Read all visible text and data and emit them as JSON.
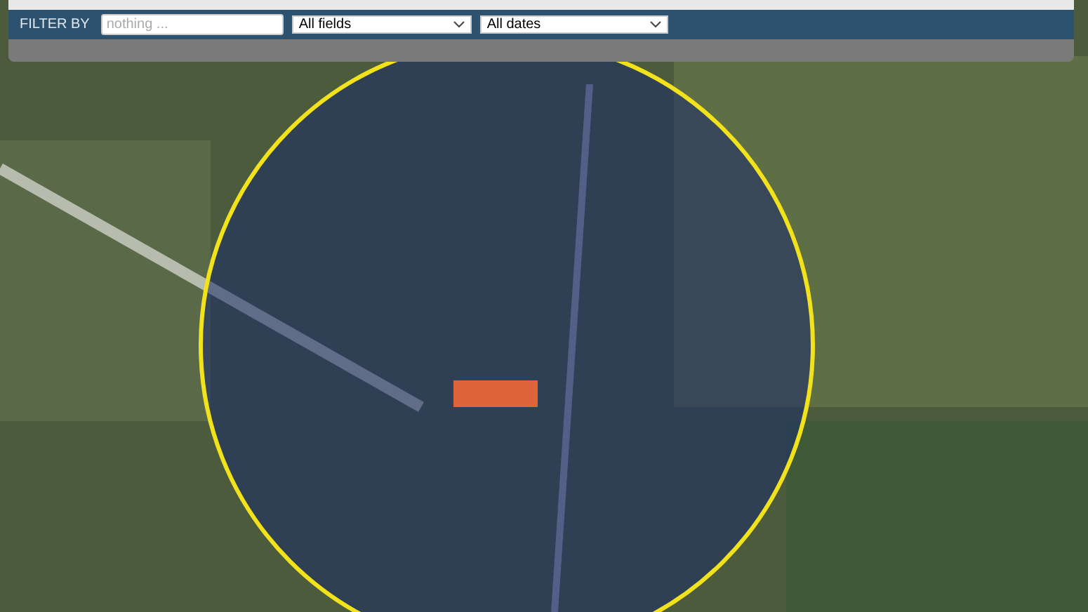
{
  "filter_bar": {
    "label": "FILTER BY",
    "search": {
      "placeholder": "nothing ..."
    },
    "dropdowns": [
      {
        "value": "All fields"
      },
      {
        "value": "All dates"
      }
    ]
  }
}
